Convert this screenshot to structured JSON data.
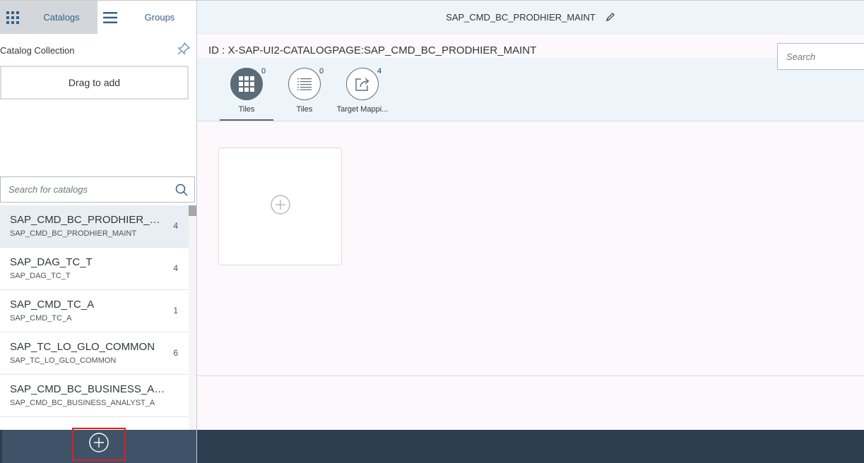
{
  "nav": {
    "catalogs_label": "Catalogs",
    "groups_label": "Groups"
  },
  "collection": {
    "title": "Catalog Collection",
    "drag_label": "Drag to add"
  },
  "catalog_search": {
    "placeholder": "Search for catalogs"
  },
  "catalogs": [
    {
      "title": "SAP_CMD_BC_PRODHIER_M...",
      "subtitle": "SAP_CMD_BC_PRODHIER_MAINT",
      "count": "4",
      "selected": true
    },
    {
      "title": "SAP_DAG_TC_T",
      "subtitle": "SAP_DAG_TC_T",
      "count": "4",
      "selected": false
    },
    {
      "title": "SAP_CMD_TC_A",
      "subtitle": "SAP_CMD_TC_A",
      "count": "1",
      "selected": false
    },
    {
      "title": "SAP_TC_LO_GLO_COMMON",
      "subtitle": "SAP_TC_LO_GLO_COMMON",
      "count": "6",
      "selected": false
    },
    {
      "title": "SAP_CMD_BC_BUSINESS_ANAL...",
      "subtitle": "SAP_CMD_BC_BUSINESS_ANALYST_A",
      "count": "",
      "selected": false
    }
  ],
  "header": {
    "title": "SAP_CMD_BC_PRODHIER_MAINT",
    "id_line": "ID : X-SAP-UI2-CATALOGPAGE:SAP_CMD_BC_PRODHIER_MAINT"
  },
  "tile_search": {
    "placeholder": "Search"
  },
  "tabs": [
    {
      "label": "Tiles",
      "count": "0",
      "icon": "grid-icon",
      "active": true
    },
    {
      "label": "Tiles",
      "count": "0",
      "icon": "list-icon",
      "active": false
    },
    {
      "label": "Target Mappi...",
      "count": "4",
      "icon": "share-icon",
      "active": false
    }
  ],
  "colors": {
    "accent": "#346187",
    "footer": "#2c3e50",
    "highlight": "#e01e1e"
  }
}
